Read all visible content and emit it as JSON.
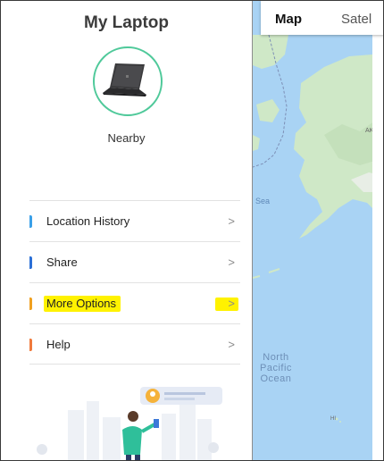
{
  "device": {
    "title": "My Laptop",
    "status": "Nearby",
    "image_icon": "laptop-icon"
  },
  "menu": {
    "items": [
      {
        "label": "Location History",
        "chevron": ">",
        "accent": "#3aa0e8",
        "highlighted": false
      },
      {
        "label": "Share",
        "chevron": ">",
        "accent": "#2b6fd6",
        "highlighted": false
      },
      {
        "label": "More Options",
        "chevron": ">",
        "accent": "#f0a020",
        "highlighted": true
      },
      {
        "label": "Help",
        "chevron": ">",
        "accent": "#f07a3c",
        "highlighted": false
      }
    ]
  },
  "map": {
    "tabs": [
      {
        "label": "Map",
        "selected": true
      },
      {
        "label": "Satel",
        "selected": false
      }
    ],
    "labels": {
      "sea": "Sea",
      "ocean_line1": "North",
      "ocean_line2": "Pacific",
      "ocean_line3": "Ocean",
      "ak": "AK",
      "hi": "HI"
    }
  },
  "colors": {
    "avatar_ring": "#4fc99a",
    "highlight": "#fff200",
    "water": "#a9d3f4",
    "land": "#cfe8c7"
  }
}
